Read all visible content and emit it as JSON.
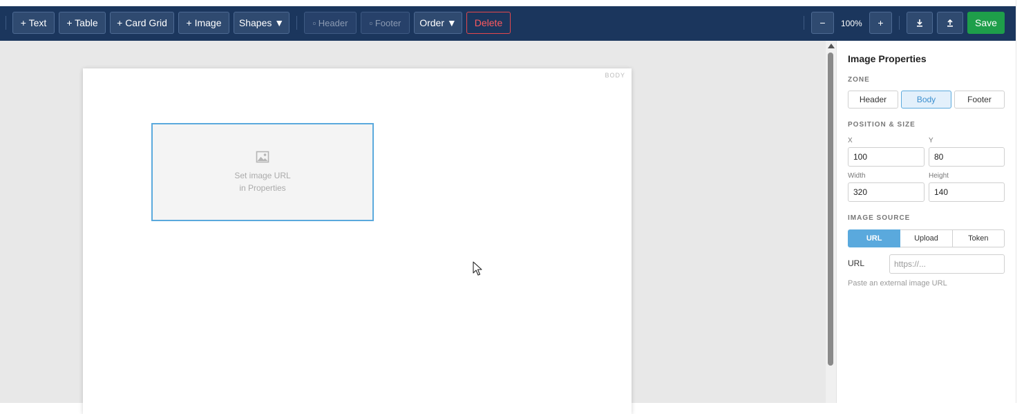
{
  "toolbar": {
    "add_text": "+ Text",
    "add_table": "+ Table",
    "add_card_grid": "+ Card Grid",
    "add_image": "+ Image",
    "shapes": "Shapes ▼",
    "header": "▫ Header",
    "footer": "▫ Footer",
    "order": "Order ▼",
    "delete": "Delete",
    "zoom_out": "−",
    "zoom_level": "100%",
    "zoom_in": "+",
    "download": "⬇",
    "upload": "⬆",
    "save": "Save"
  },
  "canvas": {
    "zone_tag": "BODY",
    "image_placeholder_line1": "Set image URL",
    "image_placeholder_line2": "in Properties"
  },
  "panel": {
    "title": "Image Properties",
    "zone_label": "ZONE",
    "zones": [
      "Header",
      "Body",
      "Footer"
    ],
    "active_zone": "Body",
    "position_label": "POSITION & SIZE",
    "x_label": "X",
    "x_value": "100",
    "y_label": "Y",
    "y_value": "80",
    "width_label": "Width",
    "width_value": "320",
    "height_label": "Height",
    "height_value": "140",
    "source_label": "IMAGE SOURCE",
    "sources": [
      "URL",
      "Upload",
      "Token"
    ],
    "active_source": "URL",
    "url_label": "URL",
    "url_placeholder": "https://...",
    "url_hint": "Paste an external image URL"
  },
  "colors": {
    "toolbar_bg": "#1b365d",
    "accent": "#5aa9dd",
    "save": "#1e9e4a",
    "danger": "#e5484d"
  }
}
